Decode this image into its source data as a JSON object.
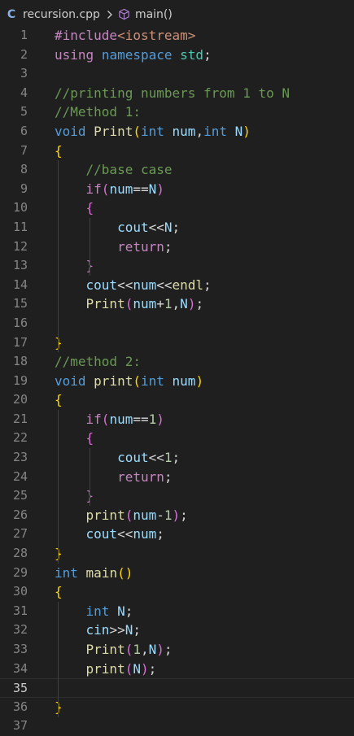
{
  "breadcrumb": {
    "file_icon": "C",
    "file_name": "recursion.cpp",
    "symbol": "main()"
  },
  "lines": [
    {
      "n": "1",
      "tokens": [
        {
          "t": "#include",
          "c": "pre"
        },
        {
          "t": "<iostream>",
          "c": "inc"
        }
      ]
    },
    {
      "n": "2",
      "tokens": [
        {
          "t": "using",
          "c": "ctl"
        },
        {
          "t": " ",
          "c": "plain"
        },
        {
          "t": "namespace",
          "c": "kw"
        },
        {
          "t": " ",
          "c": "plain"
        },
        {
          "t": "std",
          "c": "ns"
        },
        {
          "t": ";",
          "c": "plain"
        }
      ]
    },
    {
      "n": "3",
      "tokens": []
    },
    {
      "n": "4",
      "tokens": [
        {
          "t": "//printing numbers from 1 to N",
          "c": "cm"
        }
      ]
    },
    {
      "n": "5",
      "tokens": [
        {
          "t": "//Method 1:",
          "c": "cm"
        }
      ]
    },
    {
      "n": "6",
      "tokens": [
        {
          "t": "void",
          "c": "kw"
        },
        {
          "t": " ",
          "c": "plain"
        },
        {
          "t": "Print",
          "c": "fn"
        },
        {
          "t": "(",
          "c": "b1"
        },
        {
          "t": "int",
          "c": "kw"
        },
        {
          "t": " ",
          "c": "plain"
        },
        {
          "t": "num",
          "c": "var"
        },
        {
          "t": ",",
          "c": "plain"
        },
        {
          "t": "int",
          "c": "kw"
        },
        {
          "t": " ",
          "c": "plain"
        },
        {
          "t": "N",
          "c": "var"
        },
        {
          "t": ")",
          "c": "b1"
        }
      ]
    },
    {
      "n": "7",
      "tokens": [
        {
          "t": "{",
          "c": "b1"
        }
      ]
    },
    {
      "n": "8",
      "tokens": [
        {
          "t": "    ",
          "c": "plain"
        },
        {
          "t": "//base case",
          "c": "cm"
        }
      ]
    },
    {
      "n": "9",
      "tokens": [
        {
          "t": "    ",
          "c": "plain"
        },
        {
          "t": "if",
          "c": "ctl"
        },
        {
          "t": "(",
          "c": "b2"
        },
        {
          "t": "num",
          "c": "var"
        },
        {
          "t": "==",
          "c": "op"
        },
        {
          "t": "N",
          "c": "var"
        },
        {
          "t": ")",
          "c": "b2"
        }
      ]
    },
    {
      "n": "10",
      "tokens": [
        {
          "t": "    ",
          "c": "plain"
        },
        {
          "t": "{",
          "c": "b2"
        }
      ]
    },
    {
      "n": "11",
      "tokens": [
        {
          "t": "        ",
          "c": "plain"
        },
        {
          "t": "cout",
          "c": "var"
        },
        {
          "t": "<<",
          "c": "op"
        },
        {
          "t": "N",
          "c": "var"
        },
        {
          "t": ";",
          "c": "plain"
        }
      ]
    },
    {
      "n": "12",
      "tokens": [
        {
          "t": "        ",
          "c": "plain"
        },
        {
          "t": "return",
          "c": "ctl"
        },
        {
          "t": ";",
          "c": "plain"
        }
      ]
    },
    {
      "n": "13",
      "tokens": [
        {
          "t": "    ",
          "c": "plain"
        },
        {
          "t": "}",
          "c": "b2"
        }
      ]
    },
    {
      "n": "14",
      "tokens": [
        {
          "t": "    ",
          "c": "plain"
        },
        {
          "t": "cout",
          "c": "var"
        },
        {
          "t": "<<",
          "c": "op"
        },
        {
          "t": "num",
          "c": "var"
        },
        {
          "t": "<<",
          "c": "op"
        },
        {
          "t": "endl",
          "c": "fn"
        },
        {
          "t": ";",
          "c": "plain"
        }
      ]
    },
    {
      "n": "15",
      "tokens": [
        {
          "t": "    ",
          "c": "plain"
        },
        {
          "t": "Print",
          "c": "fn"
        },
        {
          "t": "(",
          "c": "b2"
        },
        {
          "t": "num",
          "c": "var"
        },
        {
          "t": "+",
          "c": "op"
        },
        {
          "t": "1",
          "c": "num"
        },
        {
          "t": ",",
          "c": "plain"
        },
        {
          "t": "N",
          "c": "var"
        },
        {
          "t": ")",
          "c": "b2"
        },
        {
          "t": ";",
          "c": "plain"
        }
      ]
    },
    {
      "n": "16",
      "tokens": []
    },
    {
      "n": "17",
      "tokens": [
        {
          "t": "}",
          "c": "b1"
        }
      ]
    },
    {
      "n": "18",
      "tokens": [
        {
          "t": "//method 2:",
          "c": "cm"
        }
      ]
    },
    {
      "n": "19",
      "tokens": [
        {
          "t": "void",
          "c": "kw"
        },
        {
          "t": " ",
          "c": "plain"
        },
        {
          "t": "print",
          "c": "fn"
        },
        {
          "t": "(",
          "c": "b1"
        },
        {
          "t": "int",
          "c": "kw"
        },
        {
          "t": " ",
          "c": "plain"
        },
        {
          "t": "num",
          "c": "var"
        },
        {
          "t": ")",
          "c": "b1"
        }
      ]
    },
    {
      "n": "20",
      "tokens": [
        {
          "t": "{",
          "c": "b1"
        }
      ]
    },
    {
      "n": "21",
      "tokens": [
        {
          "t": "    ",
          "c": "plain"
        },
        {
          "t": "if",
          "c": "ctl"
        },
        {
          "t": "(",
          "c": "b2"
        },
        {
          "t": "num",
          "c": "var"
        },
        {
          "t": "==",
          "c": "op"
        },
        {
          "t": "1",
          "c": "num"
        },
        {
          "t": ")",
          "c": "b2"
        }
      ]
    },
    {
      "n": "22",
      "tokens": [
        {
          "t": "    ",
          "c": "plain"
        },
        {
          "t": "{",
          "c": "b2"
        }
      ]
    },
    {
      "n": "23",
      "tokens": [
        {
          "t": "        ",
          "c": "plain"
        },
        {
          "t": "cout",
          "c": "var"
        },
        {
          "t": "<<",
          "c": "op"
        },
        {
          "t": "1",
          "c": "num"
        },
        {
          "t": ";",
          "c": "plain"
        }
      ]
    },
    {
      "n": "24",
      "tokens": [
        {
          "t": "        ",
          "c": "plain"
        },
        {
          "t": "return",
          "c": "ctl"
        },
        {
          "t": ";",
          "c": "plain"
        }
      ]
    },
    {
      "n": "25",
      "tokens": [
        {
          "t": "    ",
          "c": "plain"
        },
        {
          "t": "}",
          "c": "b2"
        }
      ]
    },
    {
      "n": "26",
      "tokens": [
        {
          "t": "    ",
          "c": "plain"
        },
        {
          "t": "print",
          "c": "fn"
        },
        {
          "t": "(",
          "c": "b2"
        },
        {
          "t": "num",
          "c": "var"
        },
        {
          "t": "-",
          "c": "op"
        },
        {
          "t": "1",
          "c": "num"
        },
        {
          "t": ")",
          "c": "b2"
        },
        {
          "t": ";",
          "c": "plain"
        }
      ]
    },
    {
      "n": "27",
      "tokens": [
        {
          "t": "    ",
          "c": "plain"
        },
        {
          "t": "cout",
          "c": "var"
        },
        {
          "t": "<<",
          "c": "op"
        },
        {
          "t": "num",
          "c": "var"
        },
        {
          "t": ";",
          "c": "plain"
        }
      ]
    },
    {
      "n": "28",
      "tokens": [
        {
          "t": "}",
          "c": "b1"
        }
      ]
    },
    {
      "n": "29",
      "tokens": [
        {
          "t": "int",
          "c": "kw"
        },
        {
          "t": " ",
          "c": "plain"
        },
        {
          "t": "main",
          "c": "fn"
        },
        {
          "t": "()",
          "c": "b1"
        }
      ]
    },
    {
      "n": "30",
      "tokens": [
        {
          "t": "{",
          "c": "b1"
        }
      ]
    },
    {
      "n": "31",
      "tokens": [
        {
          "t": "    ",
          "c": "plain"
        },
        {
          "t": "int",
          "c": "kw"
        },
        {
          "t": " ",
          "c": "plain"
        },
        {
          "t": "N",
          "c": "var"
        },
        {
          "t": ";",
          "c": "plain"
        }
      ]
    },
    {
      "n": "32",
      "tokens": [
        {
          "t": "    ",
          "c": "plain"
        },
        {
          "t": "cin",
          "c": "var"
        },
        {
          "t": ">>",
          "c": "op"
        },
        {
          "t": "N",
          "c": "var"
        },
        {
          "t": ";",
          "c": "plain"
        }
      ]
    },
    {
      "n": "33",
      "tokens": [
        {
          "t": "    ",
          "c": "plain"
        },
        {
          "t": "Print",
          "c": "fn"
        },
        {
          "t": "(",
          "c": "b2"
        },
        {
          "t": "1",
          "c": "num"
        },
        {
          "t": ",",
          "c": "plain"
        },
        {
          "t": "N",
          "c": "var"
        },
        {
          "t": ")",
          "c": "b2"
        },
        {
          "t": ";",
          "c": "plain"
        }
      ]
    },
    {
      "n": "34",
      "tokens": [
        {
          "t": "    ",
          "c": "plain"
        },
        {
          "t": "print",
          "c": "fn"
        },
        {
          "t": "(",
          "c": "b2"
        },
        {
          "t": "N",
          "c": "var"
        },
        {
          "t": ")",
          "c": "b2"
        },
        {
          "t": ";",
          "c": "plain"
        }
      ]
    },
    {
      "n": "35",
      "tokens": [],
      "current": true
    },
    {
      "n": "36",
      "tokens": [
        {
          "t": "}",
          "c": "b1"
        }
      ]
    },
    {
      "n": "37",
      "tokens": []
    }
  ]
}
